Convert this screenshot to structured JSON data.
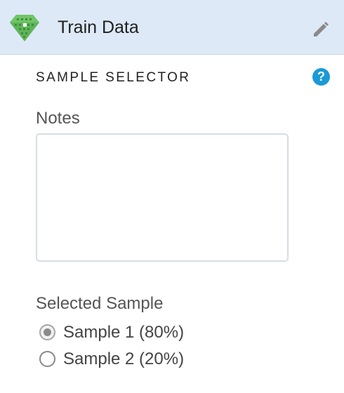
{
  "header": {
    "title": "Train Data",
    "node_icon": "gem-icon",
    "edit_icon": "pencil-icon"
  },
  "section": {
    "title": "SAMPLE SELECTOR",
    "help_icon": "question-mark-icon",
    "help_glyph": "?"
  },
  "notes": {
    "label": "Notes",
    "value": "",
    "placeholder": ""
  },
  "sample": {
    "label": "Selected Sample",
    "selected_index": 0,
    "options": [
      {
        "label": "Sample 1 (80%)",
        "checked": true
      },
      {
        "label": "Sample 2 (20%)",
        "checked": false
      }
    ]
  },
  "colors": {
    "header_bg": "#dde9f6",
    "accent": "#1a9ad6",
    "gem_green": "#5cb85c"
  }
}
